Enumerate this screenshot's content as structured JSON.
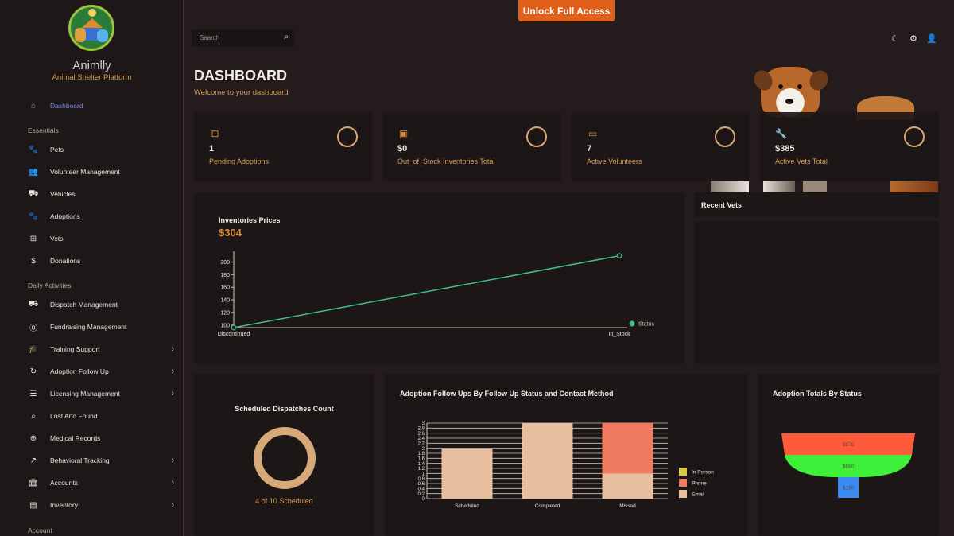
{
  "header": {
    "unlock_label": "Unlock Full Access",
    "search_placeholder": "Search"
  },
  "sidebar": {
    "brand": "Animlly",
    "tagline": "Animal Shelter Platform",
    "dashboard_label": "Dashboard",
    "section_essentials": "Essentials",
    "essentials": [
      {
        "label": "Pets",
        "icon": "paw-icon"
      },
      {
        "label": "Volunteer Management",
        "icon": "people-icon"
      },
      {
        "label": "Vehicles",
        "icon": "car-icon"
      },
      {
        "label": "Adoptions",
        "icon": "paw-icon"
      },
      {
        "label": "Vets",
        "icon": "medical-plus-icon"
      },
      {
        "label": "Donations",
        "icon": "dollar-icon"
      }
    ],
    "section_daily": "Daily Activities",
    "daily": [
      {
        "label": "Dispatch Management",
        "icon": "truck-icon"
      },
      {
        "label": "Fundraising Management",
        "icon": "coin-icon"
      },
      {
        "label": "Training Support",
        "icon": "graduation-cap-icon"
      },
      {
        "label": "Adoption Follow Up",
        "icon": "refresh-icon"
      },
      {
        "label": "Licensing Management",
        "icon": "document-icon"
      },
      {
        "label": "Lost And Found",
        "icon": "search-document-icon"
      },
      {
        "label": "Medical Records",
        "icon": "medical-bag-icon"
      },
      {
        "label": "Behavioral Tracking",
        "icon": "trend-icon"
      },
      {
        "label": "Accounts",
        "icon": "bank-icon"
      },
      {
        "label": "Inventory",
        "icon": "archive-icon"
      }
    ],
    "section_account": "Account"
  },
  "main": {
    "title": "DASHBOARD",
    "subtitle": "Welcome to your dashboard",
    "stats": [
      {
        "value": "1",
        "label": "Pending Adoptions",
        "icon": "badge-icon"
      },
      {
        "value": "$0",
        "label": "Out_of_Stock Inventories Total",
        "icon": "money-icon"
      },
      {
        "value": "7",
        "label": "Active Volunteers",
        "icon": "wallet-icon"
      },
      {
        "value": "$385",
        "label": "Active Vets Total",
        "icon": "wrench-icon"
      }
    ],
    "inventories": {
      "title": "Inventories Prices",
      "total": "$304"
    },
    "recent_vets_title": "Recent Vets",
    "dispatch": {
      "title": "Scheduled Dispatches Count",
      "caption": "4 of 10 Scheduled",
      "scheduled": 4,
      "total": 10
    },
    "followups_title": "Adoption Follow Ups By Follow Up Status and Contact Method",
    "totals_title": "Adoption Totals By Status"
  },
  "chart_data": [
    {
      "type": "line",
      "title": "Inventories Prices",
      "categories": [
        "Discontinued",
        "In_Stock"
      ],
      "series": [
        {
          "name": "Status",
          "values": [
            96,
            210
          ]
        }
      ],
      "y_ticks": [
        100,
        120,
        140,
        160,
        180,
        200
      ],
      "ylim": [
        96,
        212
      ],
      "color": "#3fbf8c",
      "legend": "right"
    },
    {
      "type": "bar",
      "stacked": true,
      "title": "Adoption Follow Ups By Follow Up Status and Contact Method",
      "categories": [
        "Scheduled",
        "Completed",
        "Missed"
      ],
      "series": [
        {
          "name": "In Person",
          "values": [
            0,
            0,
            0
          ],
          "color": "#d8c84a"
        },
        {
          "name": "Phone",
          "values": [
            0,
            0,
            2
          ],
          "color": "#f07a62"
        },
        {
          "name": "Email",
          "values": [
            2,
            3,
            1
          ],
          "color": "#e8c0a0"
        }
      ],
      "y_ticks": [
        "0",
        "0.2",
        "0.4",
        "0.6",
        "0.8",
        "1",
        "1.2",
        "1.4",
        "1.6",
        "1.8",
        "2",
        "2.2",
        "2.4",
        "2.6",
        "2.8",
        "3"
      ],
      "ylim": [
        0,
        3
      ],
      "legend": "right"
    },
    {
      "type": "funnel",
      "title": "Adoption Totals By Status",
      "labels": [
        "$575",
        "$680",
        "$150"
      ],
      "values": [
        575,
        680,
        150
      ],
      "colors": [
        "#ff5a3a",
        "#3ef03a",
        "#3a8af0"
      ]
    }
  ]
}
